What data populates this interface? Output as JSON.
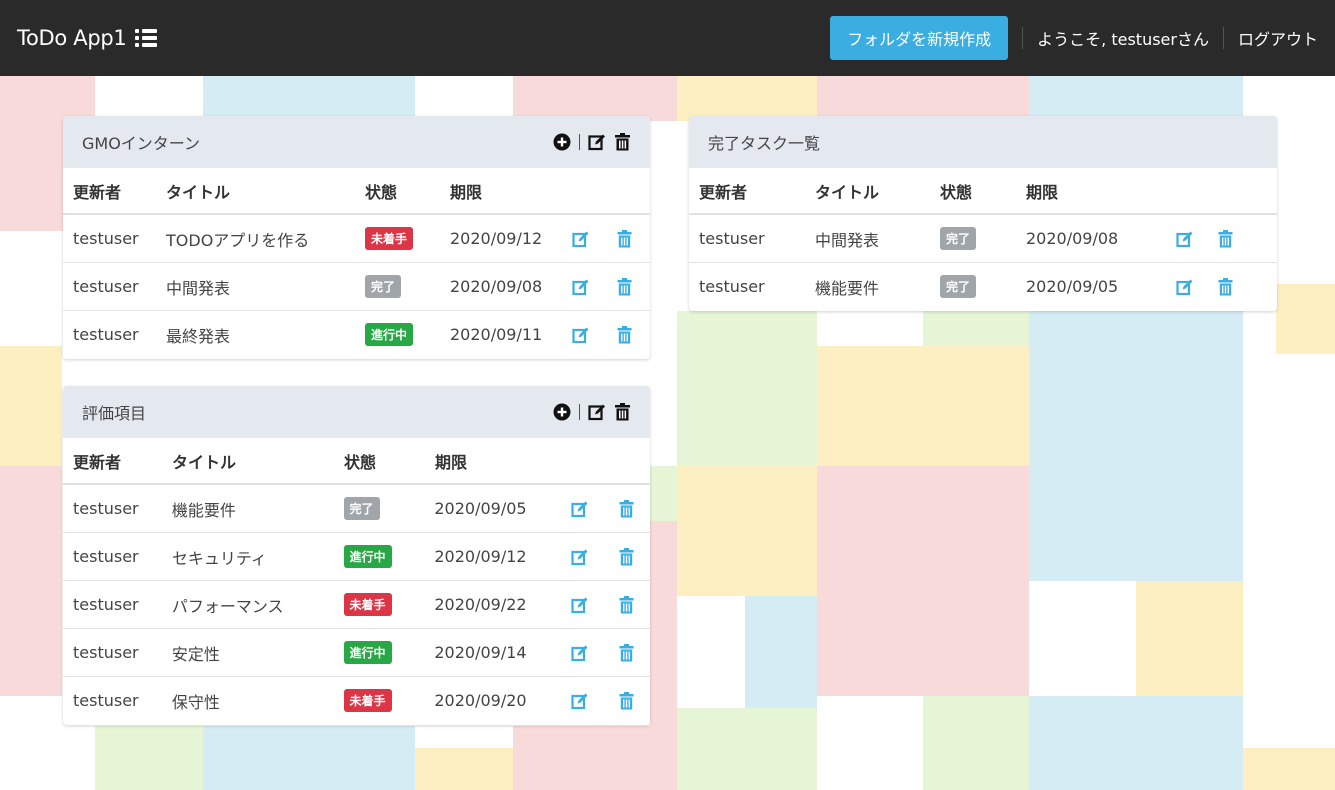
{
  "navbar": {
    "brand": "ToDo App1",
    "new_folder": "フォルダを新規作成",
    "welcome": "ようこそ, testuserさん",
    "logout": "ログアウト"
  },
  "colors": {
    "nav_bg": "#2a2a2a",
    "new_folder_btn": "#3aaee0",
    "badge_todo": "#dc3545",
    "badge_done": "#a0a5aa",
    "badge_doing": "#28a745",
    "action_icon": "#3aaee0",
    "panel_header": "#e4e8ef"
  },
  "columns": {
    "author": "更新者",
    "title": "タイトル",
    "status": "状態",
    "due": "期限"
  },
  "folders": [
    {
      "name": "GMOインターン",
      "tasks": [
        {
          "author": "testuser",
          "title": "TODOアプリを作る",
          "status": "未着手",
          "status_type": "todo",
          "due": "2020/09/12"
        },
        {
          "author": "testuser",
          "title": "中間発表",
          "status": "完了",
          "status_type": "done",
          "due": "2020/09/08"
        },
        {
          "author": "testuser",
          "title": "最終発表",
          "status": "進行中",
          "status_type": "doing",
          "due": "2020/09/11"
        }
      ]
    },
    {
      "name": "評価項目",
      "tasks": [
        {
          "author": "testuser",
          "title": "機能要件",
          "status": "完了",
          "status_type": "done",
          "due": "2020/09/05"
        },
        {
          "author": "testuser",
          "title": "セキュリティ",
          "status": "進行中",
          "status_type": "doing",
          "due": "2020/09/12"
        },
        {
          "author": "testuser",
          "title": "パフォーマンス",
          "status": "未着手",
          "status_type": "todo",
          "due": "2020/09/22"
        },
        {
          "author": "testuser",
          "title": "安定性",
          "status": "進行中",
          "status_type": "doing",
          "due": "2020/09/14"
        },
        {
          "author": "testuser",
          "title": "保守性",
          "status": "未着手",
          "status_type": "todo",
          "due": "2020/09/20"
        }
      ]
    }
  ],
  "completed": {
    "name": "完了タスク一覧",
    "tasks": [
      {
        "author": "testuser",
        "title": "中間発表",
        "status": "完了",
        "status_type": "done",
        "due": "2020/09/08"
      },
      {
        "author": "testuser",
        "title": "機能要件",
        "status": "完了",
        "status_type": "done",
        "due": "2020/09/05"
      }
    ]
  }
}
